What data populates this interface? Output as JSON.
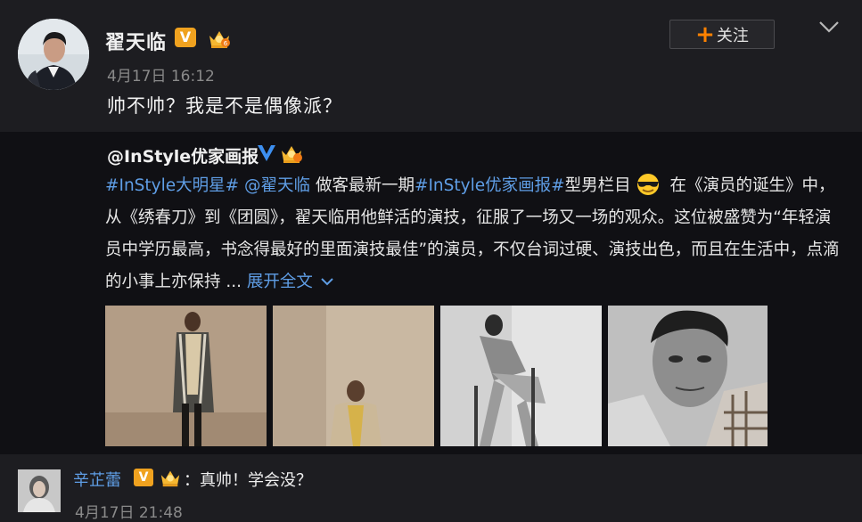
{
  "post": {
    "username": "翟天临",
    "verified_badge": "V",
    "timestamp": "4月17日 16:12",
    "follow_label": "关注",
    "follow_plus": "+",
    "text": "帅不帅？我是不是偶像派？"
  },
  "repost": {
    "author": "@InStyle优家画报",
    "segments": [
      {
        "text": "#InStyle大明星#",
        "link": true
      },
      {
        "text": " ",
        "link": false
      },
      {
        "text": "@翟天临",
        "link": true
      },
      {
        "text": " 做客最新一期",
        "link": false
      },
      {
        "text": "#InStyle优家画报#",
        "link": true
      },
      {
        "text": "型男栏目",
        "link": false
      },
      {
        "emoji": "sunglasses-emoji"
      },
      {
        "text": " 在《演员的诞生》中，从《绣春刀》到《团圆》，翟天临用他鲜活的演技，征服了一场又一场的观众。这位被盛赞为“年轻演员中学历最高，书念得最好的里面演技最佳”的演员，不仅台词过硬、演技出色，而且在生活中，点滴的小事上亦保持 ... ",
        "link": false
      },
      {
        "text": "展开全文",
        "link": true,
        "expand": true
      }
    ],
    "photos": [
      "photo-standing-plaid-coat",
      "photo-seated-floor",
      "photo-chair-pose",
      "photo-closeup-portrait"
    ]
  },
  "comment": {
    "username": "辛芷蕾",
    "verified_badge": "V",
    "text": "：真帅！学会没？",
    "timestamp": "4月17日 21:48"
  },
  "colors": {
    "link": "#5f9ee6",
    "accent_orange": "#ff8200",
    "badge_orange": "#f0a21f",
    "background": "#1a1a1e",
    "repost_background": "#101014"
  }
}
